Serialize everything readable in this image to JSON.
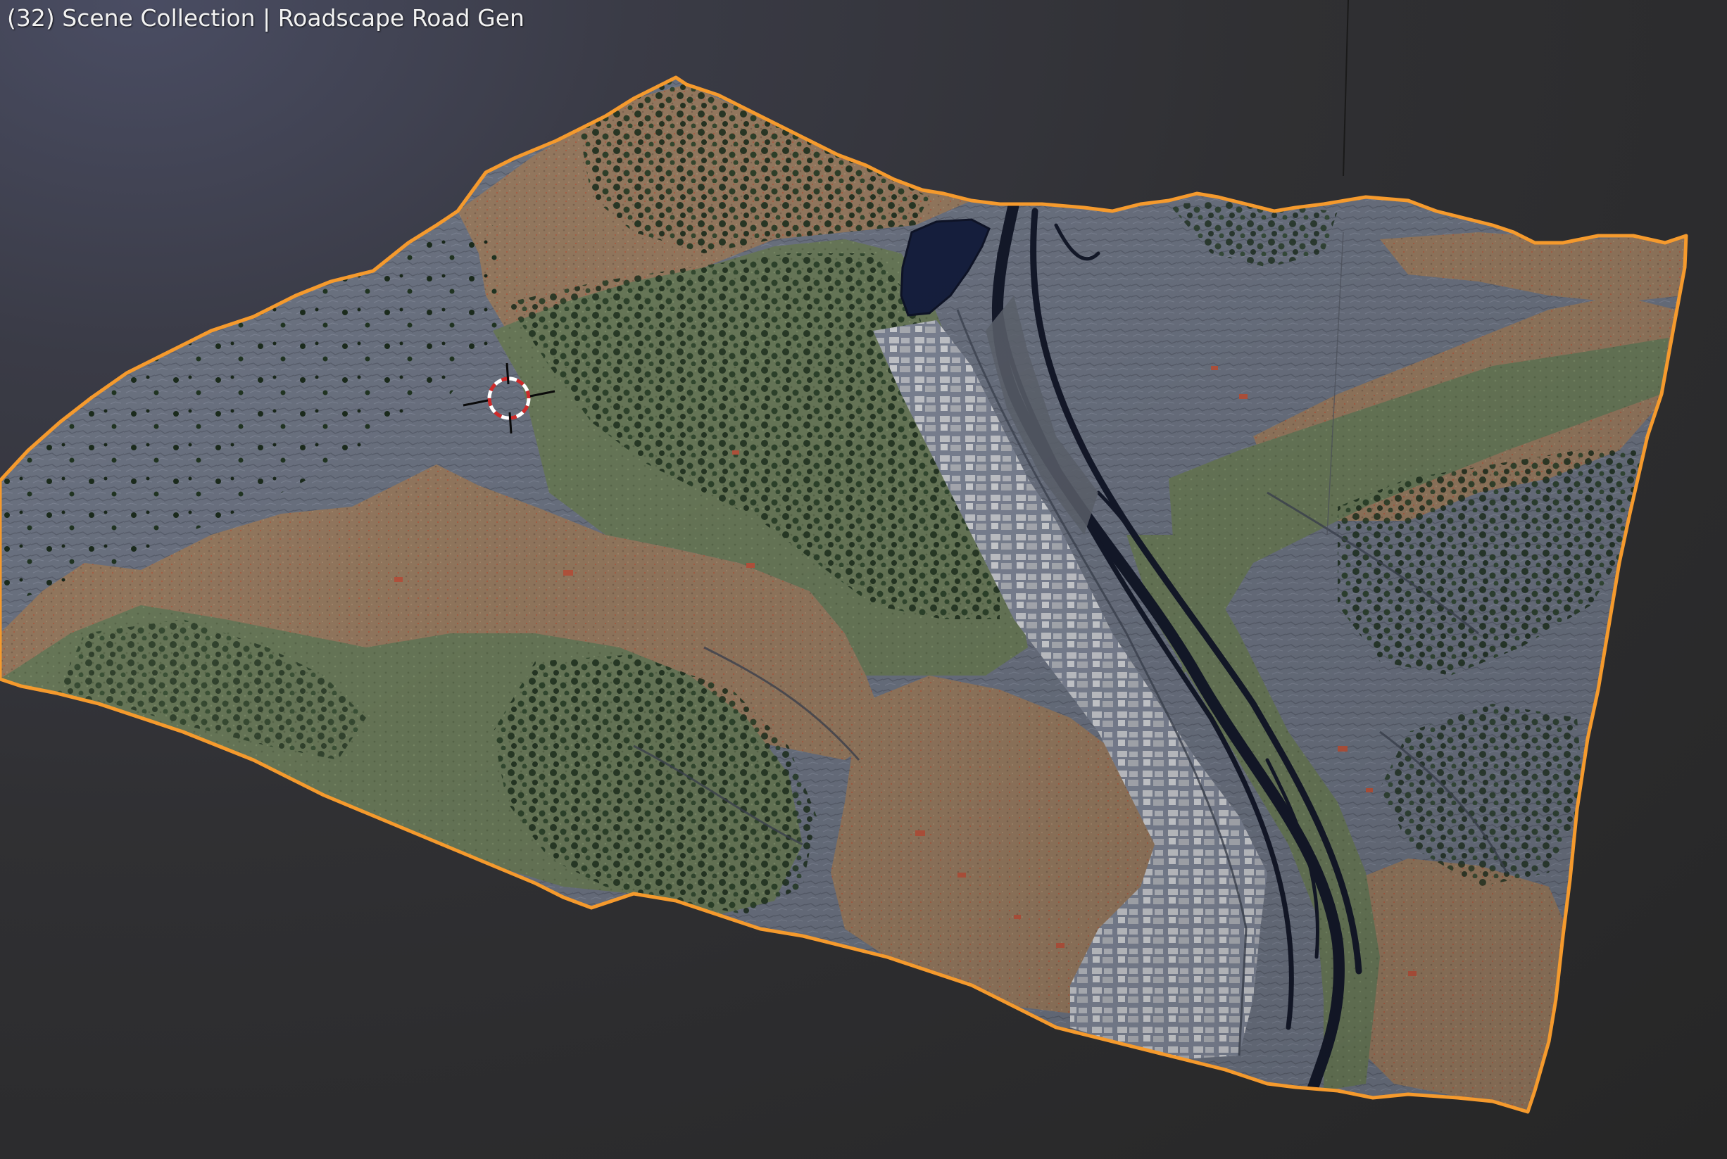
{
  "viewport": {
    "frame_number": "(32)",
    "collection_name": "Scene Collection",
    "separator": "|",
    "active_object": "Roadscape Road Gen"
  },
  "colors": {
    "background_top": "#4a4d63",
    "background_bottom": "#262626",
    "selection_outline": "#f59a2d",
    "rock": "#6f7684",
    "dirt": "#9a7d62",
    "grass": "#6d7f5c",
    "tree": "#1f3320",
    "water": "#1a1f30",
    "lake": "#16203f",
    "building": "#c9cbd0",
    "roof_red": "#b8553e"
  },
  "icons": {
    "cursor": "3d-cursor-icon"
  }
}
